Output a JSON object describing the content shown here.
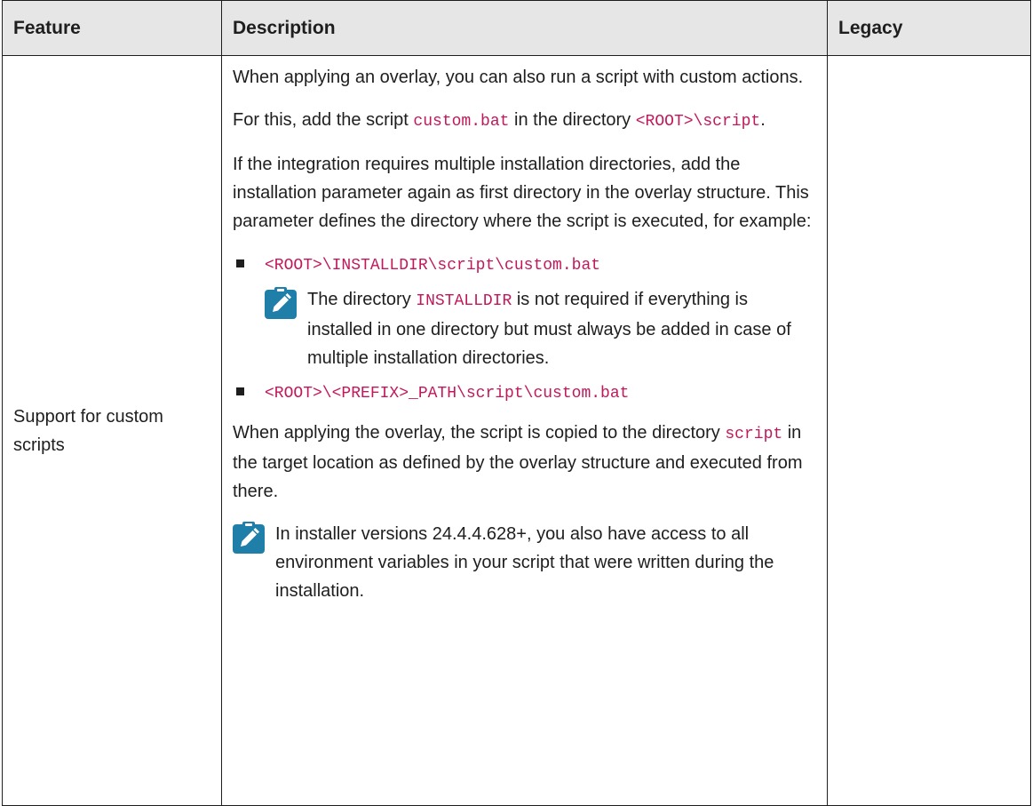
{
  "header": {
    "feature": "Feature",
    "description": "Description",
    "legacy": "Legacy"
  },
  "row": {
    "feature": "Support for custom scripts",
    "para1": "When applying an overlay, you can also run a script with custom actions.",
    "para2_a": "For this, add the script ",
    "para2_code1": "custom.bat",
    "para2_b": " in the directory ",
    "para2_code2": "<ROOT>\\script",
    "para2_c": ".",
    "para3": "If the integration requires multiple installation directories, add the installation parameter again as first directory in the overlay structure. This parameter defines the directory where the script is executed, for example:",
    "bullet1": "<ROOT>\\INSTALLDIR\\script\\custom.bat",
    "note1_a": "The directory ",
    "note1_code": "INSTALLDIR",
    "note1_b": " is not required if everything is installed in one directory but must always be added in case of multiple installation directories.",
    "bullet2": "<ROOT>\\<PREFIX>_PATH\\script\\custom.bat",
    "para4_a": "When applying the overlay, the script is copied to the directory ",
    "para4_code": "script",
    "para4_b": " in the target location as defined by the overlay structure and executed from there.",
    "note2": "In installer versions 24.4.4.628+, you also have access to all environment variables in your script that were written during the installation.",
    "legacy": ""
  },
  "colors": {
    "note_icon": "#1f7fa8",
    "code": "#c2185b",
    "header_bg": "#e6e6e6"
  },
  "icons": {
    "note": "note-pencil-icon",
    "bullet": "square-bullet-icon"
  }
}
